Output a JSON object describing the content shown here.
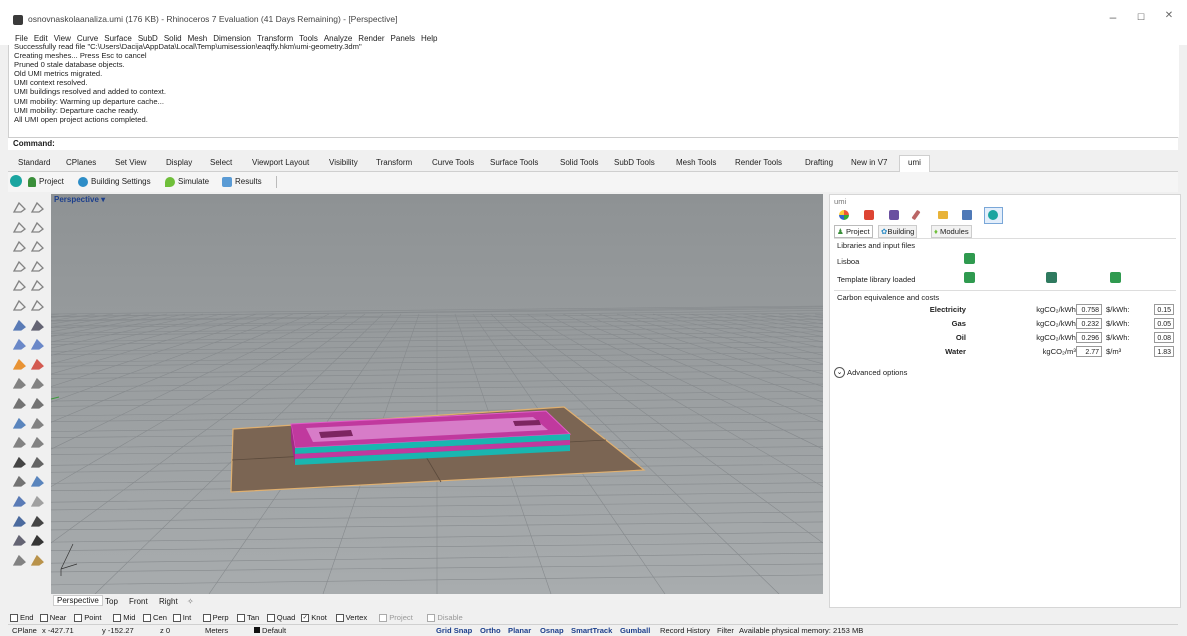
{
  "window": {
    "title": "osnovnaskolaanaliza.umi (176 KB) - Rhinoceros 7 Evaluation (41 Days Remaining) - [Perspective]",
    "min": "–",
    "max": "☐",
    "close": "✕"
  },
  "menu": [
    "File",
    "Edit",
    "View",
    "Curve",
    "Surface",
    "SubD",
    "Solid",
    "Mesh",
    "Dimension",
    "Transform",
    "Tools",
    "Analyze",
    "Render",
    "Panels",
    "Help"
  ],
  "history": [
    "Successfully read file \"C:\\Users\\Dacija\\AppData\\Local\\Temp\\umisession\\eaqffy.hkm\\umi-geometry.3dm\"",
    "Creating meshes... Press Esc to cancel",
    "Pruned 0 stale database objects.",
    "Old UMI metrics migrated.",
    "UMI context resolved.",
    "UMI buildings resolved and added to context.",
    "UMI mobility: Warming up departure cache...",
    "UMI mobility: Departure cache ready.",
    "All UMI open project actions completed."
  ],
  "command_label": "Command:",
  "tabs": [
    "Standard",
    "CPlanes",
    "Set View",
    "Display",
    "Select",
    "Viewport Layout",
    "Visibility",
    "Transform",
    "Curve Tools",
    "Surface Tools",
    "Solid Tools",
    "SubD Tools",
    "Mesh Tools",
    "Render Tools",
    "Drafting",
    "New in V7",
    "umi"
  ],
  "umi_toolbar": {
    "project": "Project",
    "building_settings": "Building Settings",
    "simulate": "Simulate",
    "results": "Results"
  },
  "viewport": {
    "label": "Perspective",
    "arrow": "▾"
  },
  "view_tabs": [
    "Perspective",
    "Top",
    "Front",
    "Right",
    "✧"
  ],
  "panel": {
    "title": "umi",
    "subtabs": [
      "Project",
      "Building",
      "Modules"
    ],
    "libraries_header": "Libraries and input files",
    "lisboa": "Lisboa",
    "template_loaded": "Template library loaded",
    "carbon_header": "Carbon equivalence and costs",
    "rows": [
      {
        "name": "Electricity",
        "unit1": "kgCO₂/kWh:",
        "v1": "0.758",
        "unit2": "$/kWh:",
        "v2": "0.15"
      },
      {
        "name": "Gas",
        "unit1": "kgCO₂/kWh:",
        "v1": "0.232",
        "unit2": "$/kWh:",
        "v2": "0.05"
      },
      {
        "name": "Oil",
        "unit1": "kgCO₂/kWh:",
        "v1": "0.296",
        "unit2": "$/kWh:",
        "v2": "0.08"
      },
      {
        "name": "Water",
        "unit1": "kgCO₂/m³:",
        "v1": "2.77",
        "unit2": "$/m³",
        "v2": "1.83"
      }
    ],
    "advanced": "Advanced options"
  },
  "osnap": [
    {
      "label": "End",
      "checked": false
    },
    {
      "label": "Near",
      "checked": false
    },
    {
      "label": "Point",
      "checked": false
    },
    {
      "label": "Mid",
      "checked": false
    },
    {
      "label": "Cen",
      "checked": false
    },
    {
      "label": "Int",
      "checked": false
    },
    {
      "label": "Perp",
      "checked": false
    },
    {
      "label": "Tan",
      "checked": false
    },
    {
      "label": "Quad",
      "checked": false
    },
    {
      "label": "Knot",
      "checked": true
    },
    {
      "label": "Vertex",
      "checked": false
    },
    {
      "label": "Project",
      "checked": false
    },
    {
      "label": "Disable",
      "checked": false
    }
  ],
  "status": {
    "cplane": "CPlane",
    "x": "x -427.71",
    "y": "y -152.27",
    "z": "z 0",
    "units": "Meters",
    "layer": "Default",
    "grid_snap": "Grid Snap",
    "ortho": "Ortho",
    "planar": "Planar",
    "osnap": "Osnap",
    "smarttrack": "SmartTrack",
    "gumball": "Gumball",
    "record_history": "Record History",
    "filter": "Filter",
    "memory": "Available physical memory: 2153 MB"
  },
  "colors": {
    "viewport_bg": "#9da1a3",
    "grid": "#8b8f92",
    "site": "#7a6350",
    "building_magenta": "#c0399e",
    "building_teal": "#19b6b0",
    "accent_blue": "#1c3f8c"
  }
}
